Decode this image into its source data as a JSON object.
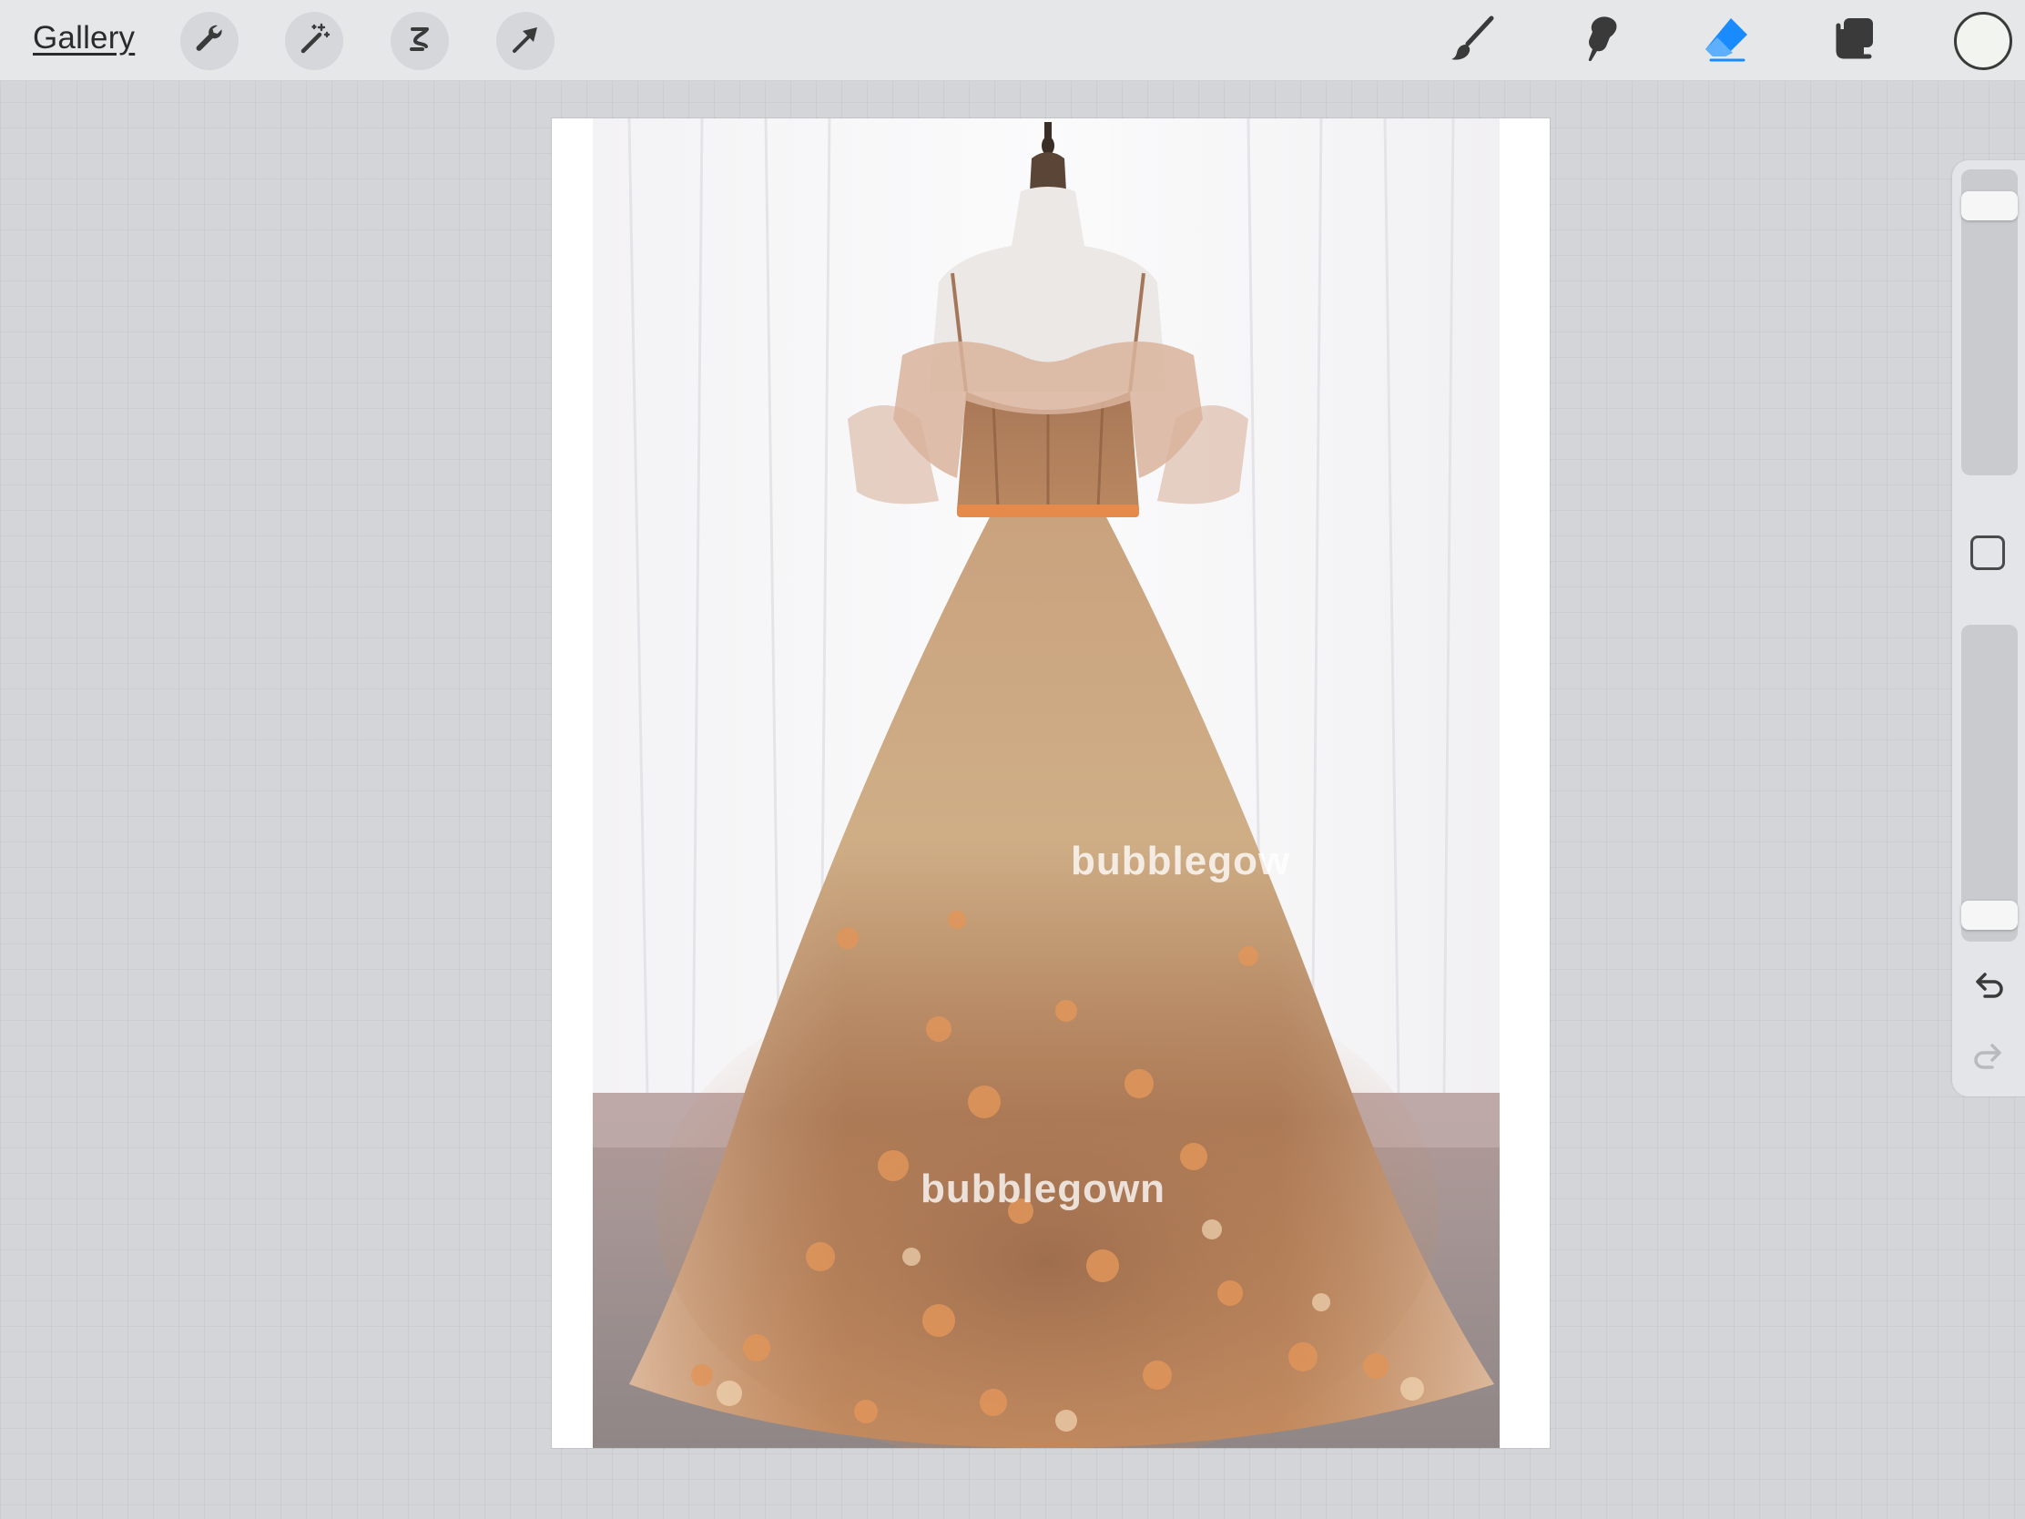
{
  "toolbar": {
    "gallery_label": "Gallery",
    "left_tools": [
      "wrench-icon",
      "magic-wand-icon",
      "selection-icon",
      "transform-arrow-icon"
    ],
    "right_tools": [
      "brush-icon",
      "smudge-icon",
      "eraser-icon",
      "layers-icon"
    ],
    "active_tool": "eraser-icon",
    "accent_color": "#1a8bff",
    "current_color": "#f2f4ef"
  },
  "canvas": {
    "watermarks": [
      "bubblegow",
      "bubblegown"
    ]
  },
  "sidebar": {
    "brush_size_level": 0.92,
    "opacity_level": 0.04,
    "icons": [
      "modify-square-icon",
      "undo-icon",
      "redo-icon"
    ]
  }
}
